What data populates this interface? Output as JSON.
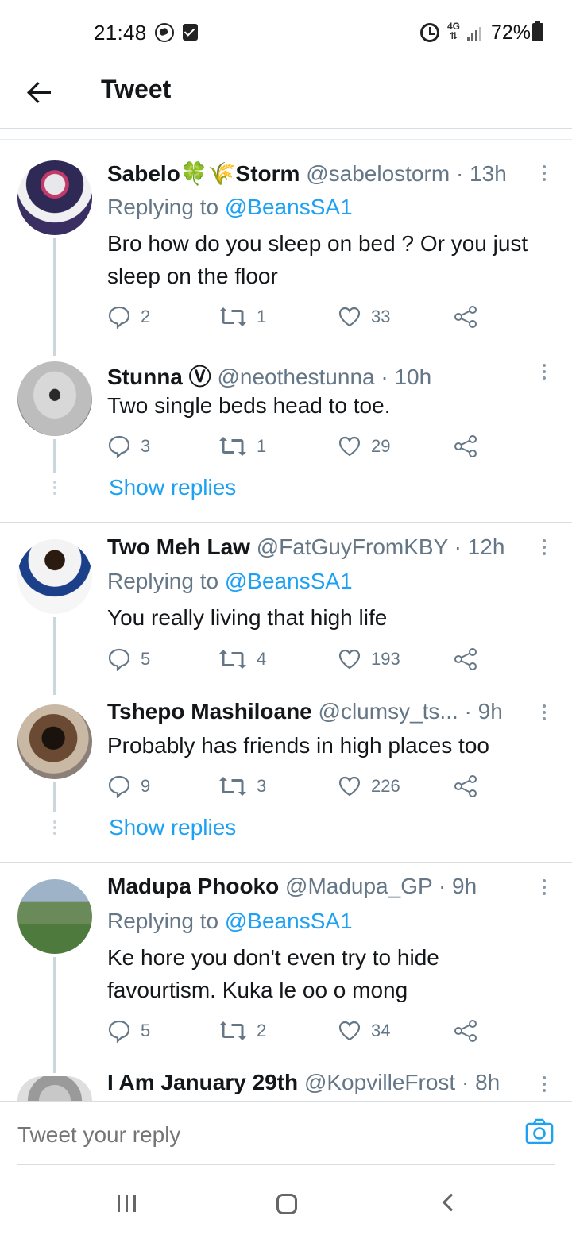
{
  "status": {
    "time": "21:48",
    "network": "4G",
    "battery": "72%"
  },
  "header": {
    "title": "Tweet"
  },
  "tweets": [
    {
      "name": "Sabelo🍀🌾Storm",
      "handle": "@sabelostorm",
      "time": "13h",
      "replying_prefix": "Replying to",
      "replying_to": "@BeansSA1",
      "text": "Bro how do you sleep on bed ? Or you just sleep on the floor",
      "replies": "2",
      "retweets": "1",
      "likes": "33"
    },
    {
      "name": "Stunna Ⓥ",
      "handle": "@neothestunna",
      "time": "10h",
      "text": "Two single beds head to toe.",
      "replies": "3",
      "retweets": "1",
      "likes": "29"
    },
    {
      "name": "Two Meh Law",
      "handle": "@FatGuyFromKBY",
      "time": "12h",
      "replying_prefix": "Replying to",
      "replying_to": "@BeansSA1",
      "text": "You really living that high life",
      "replies": "5",
      "retweets": "4",
      "likes": "193"
    },
    {
      "name": "Tshepo Mashiloane",
      "handle": "@clumsy_ts...",
      "time": "9h",
      "text": "Probably has friends in high places too",
      "replies": "9",
      "retweets": "3",
      "likes": "226"
    },
    {
      "name": "Madupa Phooko",
      "handle": "@Madupa_GP",
      "time": "9h",
      "replying_prefix": "Replying to",
      "replying_to": "@BeansSA1",
      "text": "Ke hore you don't even try to hide favourtism. Kuka le oo o mong",
      "replies": "5",
      "retweets": "2",
      "likes": "34"
    },
    {
      "name": "I Am January 29th",
      "handle": "@KopvilleFrost",
      "time": "8h"
    }
  ],
  "show_replies_label": "Show replies",
  "compose": {
    "placeholder": "Tweet your reply"
  },
  "colors": {
    "accent": "#1da1f2",
    "secondary_text": "#657786",
    "divider": "#d8dde1"
  },
  "icons": [
    "back-arrow-icon",
    "reply-icon",
    "retweet-icon",
    "like-icon",
    "share-icon",
    "more-icon",
    "camera-icon",
    "whatsapp-icon",
    "alarm-icon",
    "signal-icon",
    "battery-icon"
  ]
}
